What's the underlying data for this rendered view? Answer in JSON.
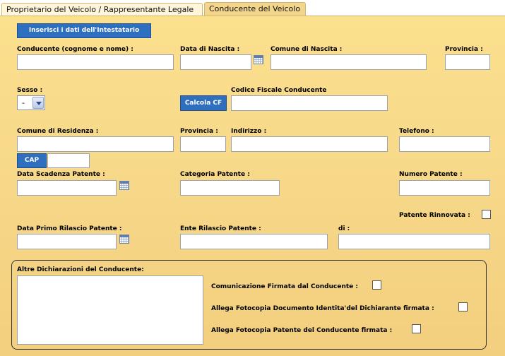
{
  "tabs": {
    "owner": "Proprietario del Veicolo / Rappresentante Legale",
    "driver": "Conducente del Veicolo"
  },
  "buttons": {
    "insert_owner": "Inserisci i dati dell'Intestatario",
    "calc_cf": "Calcola CF",
    "cap": "CAP"
  },
  "labels": {
    "driver_name": "Conducente (cognome e nome) :",
    "birth_date": "Data di Nascita :",
    "birth_city": "Comune di Nascita :",
    "birth_province": "Provincia :",
    "sex": "Sesso :",
    "tax_code": "Codice Fiscale Conducente",
    "res_city": "Comune di Residenza :",
    "res_province": "Provincia :",
    "address": "Indirizzo :",
    "phone": "Telefono :",
    "license_expiry": "Data Scadenza Patente :",
    "license_category": "Categoria Patente :",
    "license_number": "Numero Patente :",
    "license_renewed": "Patente Rinnovata :",
    "first_issue_date": "Data Primo Rilascio Patente :",
    "issuing_authority": "Ente Rilascio Patente :",
    "of": "di :",
    "other_declarations": "Altre Dichiarazioni del Conducente:",
    "signed_communication": "Comunicazione Firmata dal Conducente :",
    "attach_id_copy": "Allega Fotocopia Documento Identita'del Dichiarante firmata :",
    "attach_license_copy": "Allega Fotocopia Patente del Conducente firmata :"
  },
  "sex_select": {
    "selected": "-"
  }
}
